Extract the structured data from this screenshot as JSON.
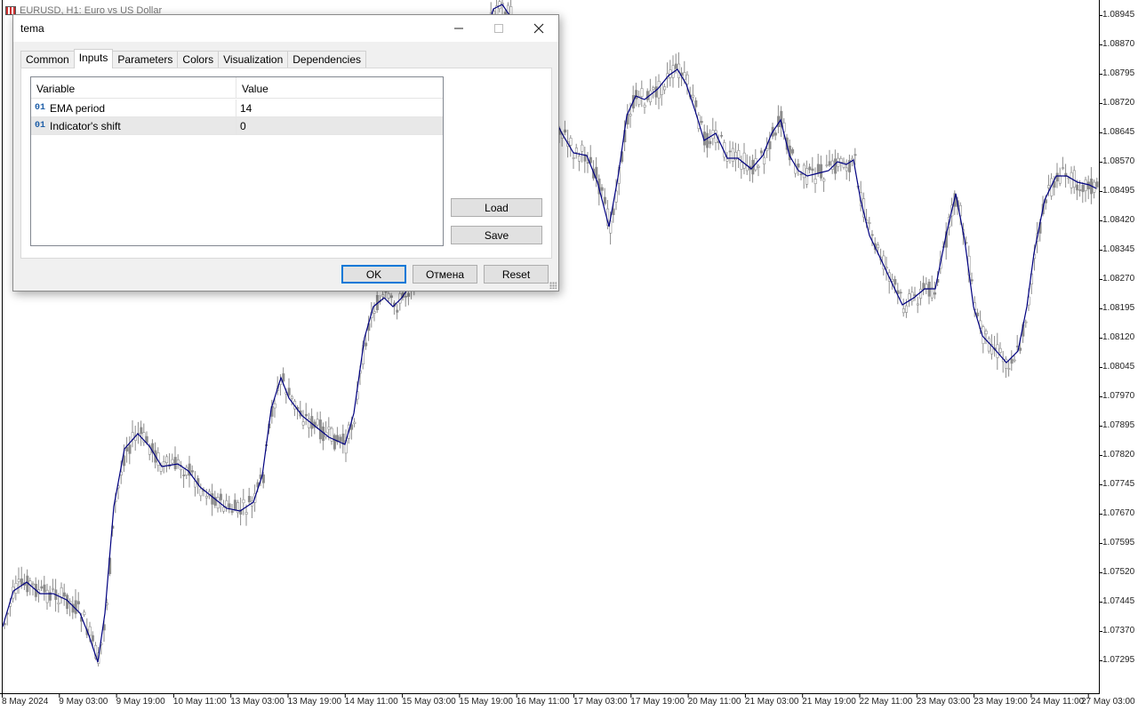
{
  "chart": {
    "title": "EURUSD, H1:  Euro vs US Dollar",
    "price_labels": [
      "1.08945",
      "1.08870",
      "1.08795",
      "1.08720",
      "1.08645",
      "1.08570",
      "1.08495",
      "1.08420",
      "1.08345",
      "1.08270",
      "1.08195",
      "1.08120",
      "1.08045",
      "1.07970",
      "1.07895",
      "1.07820",
      "1.07745",
      "1.07670",
      "1.07595",
      "1.07520",
      "1.07445",
      "1.07370",
      "1.07295"
    ],
    "time_labels": [
      "8 May 2024",
      "9 May 03:00",
      "9 May 19:00",
      "10 May 11:00",
      "13 May 03:00",
      "13 May 19:00",
      "14 May 11:00",
      "15 May 03:00",
      "15 May 19:00",
      "16 May 11:00",
      "17 May 03:00",
      "17 May 19:00",
      "20 May 11:00",
      "21 May 03:00",
      "21 May 19:00",
      "22 May 11:00",
      "23 May 03:00",
      "23 May 19:00",
      "24 May 11:00",
      "27 May 03:00"
    ],
    "candle_color": "#8c8c8c",
    "line_color": "#000080"
  },
  "dialog": {
    "title": "tema",
    "minimize_icon": "minimize-icon",
    "maximize_icon": "maximize-icon",
    "close_icon": "close-icon",
    "tabs": [
      {
        "label": "Common",
        "active": false
      },
      {
        "label": "Inputs",
        "active": true
      },
      {
        "label": "Parameters",
        "active": false
      },
      {
        "label": "Colors",
        "active": false
      },
      {
        "label": "Visualization",
        "active": false
      },
      {
        "label": "Dependencies",
        "active": false
      }
    ],
    "grid": {
      "col_variable": "Variable",
      "col_value": "Value",
      "rows": [
        {
          "type": "01",
          "variable": "EMA period",
          "value": "14"
        },
        {
          "type": "01",
          "variable": "Indicator's shift",
          "value": "0"
        }
      ]
    },
    "load_label": "Load",
    "save_label": "Save",
    "ok_label": "OK",
    "cancel_label": "Отмена",
    "reset_label": "Reset",
    "accent_color": "#0078d7"
  }
}
